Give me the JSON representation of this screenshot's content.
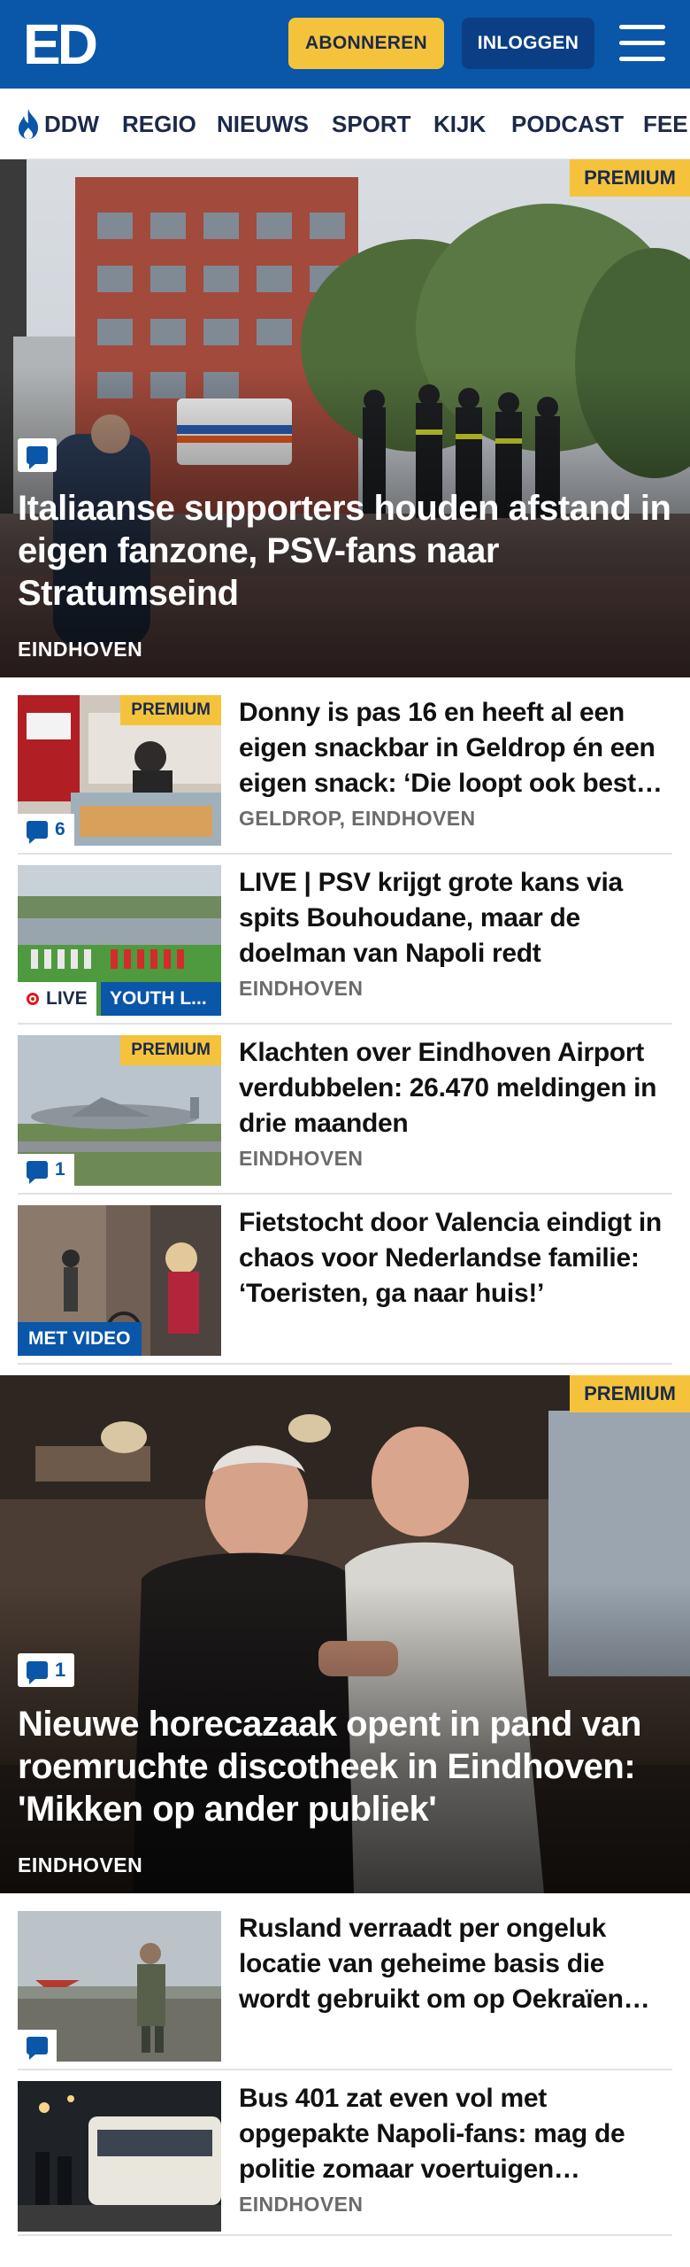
{
  "header": {
    "logo": "ED",
    "subscribe_label": "ABONNEREN",
    "login_label": "INLOGGEN",
    "brand_color": "#0a56a8",
    "accent_color": "#f5c33b"
  },
  "nav": {
    "items": [
      {
        "label": "DDW",
        "icon": "flame-icon"
      },
      {
        "label": "REGIO"
      },
      {
        "label": "NIEUWS"
      },
      {
        "label": "SPORT"
      },
      {
        "label": "KIJK"
      },
      {
        "label": "PODCAST"
      },
      {
        "label": "FEE"
      }
    ]
  },
  "hero1": {
    "badge": "PREMIUM",
    "comments_icon": "comment-icon",
    "title": "Italiaanse supporters houden afstand in eigen fanzone, PSV-fans naar Stratumseind",
    "location": "EINDHOVEN"
  },
  "articles": [
    {
      "title": "Donny is pas 16 en heeft al een eigen snackbar in Geldrop én een eigen snack: ‘Die loopt ook best…",
      "location": "GELDROP, EINDHOVEN",
      "badge": "PREMIUM",
      "comments": "6"
    },
    {
      "title": "LIVE | PSV krijgt grote kans via spits Bouhoudane, maar de doelman van Napoli redt",
      "location": "EINDHOVEN",
      "live_label": "LIVE",
      "tag": "YOUTH L..."
    },
    {
      "title": "Klachten over Eindhoven Airport verdubbelen: 26.470 meldingen in drie maanden",
      "location": "EINDHOVEN",
      "badge": "PREMIUM",
      "comments": "1"
    },
    {
      "title": "Fietstocht door Valencia eindigt in chaos voor Nederlandse familie: ‘Toeristen, ga naar huis!’",
      "video_label": "MET VIDEO"
    }
  ],
  "hero2": {
    "badge": "PREMIUM",
    "comments": "1",
    "title": "Nieuwe horecazaak opent in pand van roemruchte discotheek in Eindhoven: 'Mikken op ander publiek'",
    "location": "EINDHOVEN"
  },
  "articles2": [
    {
      "title": "Rusland verraadt per ongeluk locatie van geheime basis die wordt gebruikt om op Oekraïen…"
    },
    {
      "title": "Bus 401 zat even vol met opgepakte Napoli-fans: mag de politie zomaar voertuigen…",
      "location": "EINDHOVEN"
    }
  ]
}
